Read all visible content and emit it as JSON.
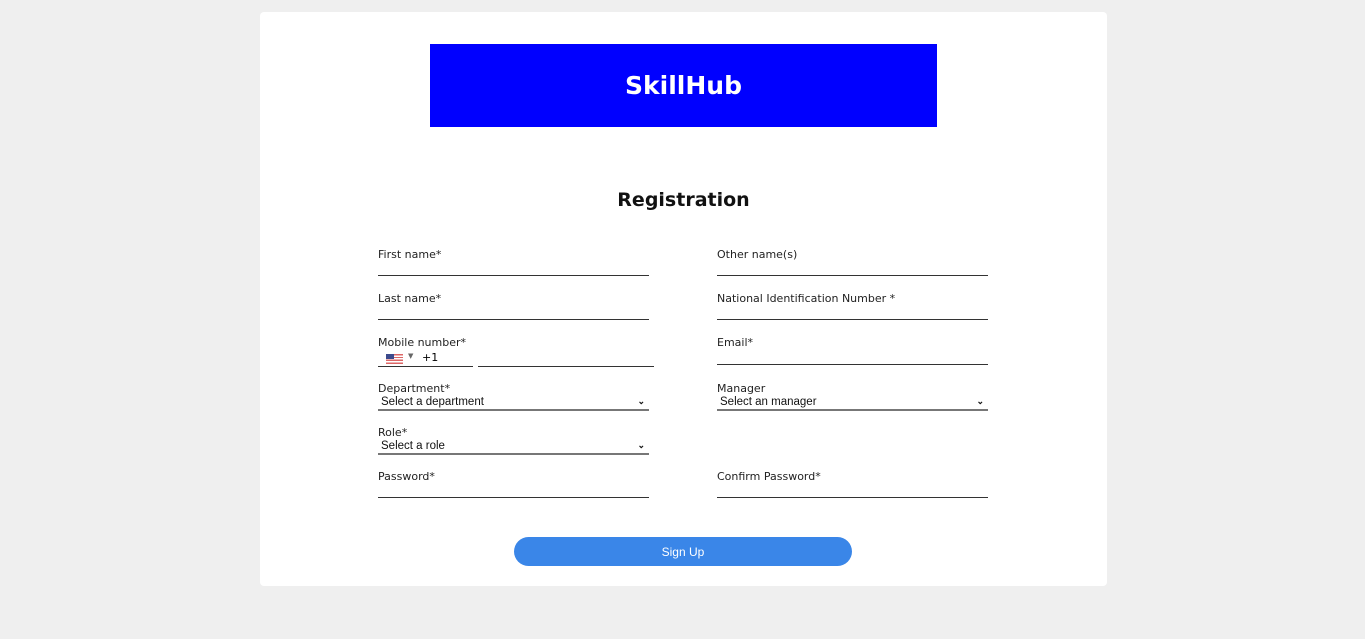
{
  "brand": {
    "name": "SkillHub",
    "color": "#0000ff"
  },
  "form": {
    "title": "Registration",
    "first_name": {
      "label": "First name*",
      "value": ""
    },
    "other_names": {
      "label": "Other name(s)",
      "value": ""
    },
    "last_name": {
      "label": "Last name*",
      "value": ""
    },
    "nin": {
      "label": "National Identification Number *",
      "value": ""
    },
    "mobile": {
      "label": "Mobile number*",
      "country": "us-flag-icon",
      "dial_code": "+1",
      "value": ""
    },
    "email": {
      "label": "Email*",
      "value": ""
    },
    "department": {
      "label": "Department*",
      "selected": "Select a department"
    },
    "manager": {
      "label": "Manager",
      "selected": "Select an manager"
    },
    "role": {
      "label": "Role*",
      "selected": "Select a role"
    },
    "password": {
      "label": "Password*",
      "value": ""
    },
    "confirm_password": {
      "label": "Confirm Password*",
      "value": ""
    },
    "submit_label": "Sign Up",
    "submit_color": "#3a86e8"
  }
}
